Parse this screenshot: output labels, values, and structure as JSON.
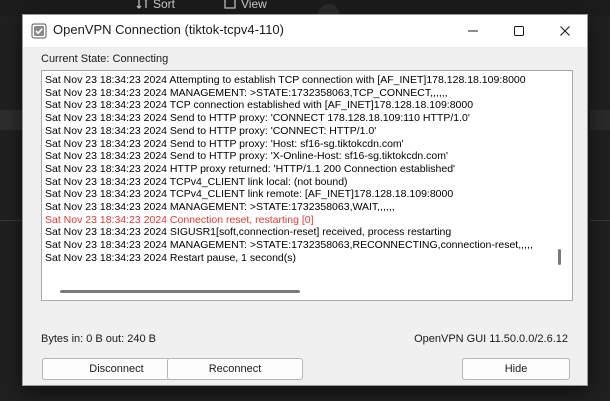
{
  "background_app": {
    "toolbar_items": [
      "Sort",
      "View"
    ]
  },
  "window": {
    "title": "OpenVPN Connection (tiktok-tcpv4-110)",
    "controls": {
      "minimize": "minimize-icon",
      "maximize": "maximize-icon",
      "close": "close-icon"
    }
  },
  "state": {
    "label": "Current State: Connecting"
  },
  "log": {
    "lines": [
      {
        "text": "Sat Nov 23 18:34:23 2024 Attempting to establish TCP connection with [AF_INET]178.128.18.109:8000",
        "level": "info"
      },
      {
        "text": "Sat Nov 23 18:34:23 2024 MANAGEMENT: >STATE:1732358063,TCP_CONNECT,,,,,,",
        "level": "info"
      },
      {
        "text": "Sat Nov 23 18:34:23 2024 TCP connection established with [AF_INET]178.128.18.109:8000",
        "level": "info"
      },
      {
        "text": "Sat Nov 23 18:34:23 2024 Send to HTTP proxy: 'CONNECT 178.128.18.109:110 HTTP/1.0'",
        "level": "info"
      },
      {
        "text": "Sat Nov 23 18:34:23 2024 Send to HTTP proxy: 'CONNECT: HTTP/1.0'",
        "level": "info"
      },
      {
        "text": "Sat Nov 23 18:34:23 2024 Send to HTTP proxy: 'Host: sf16-sg.tiktokcdn.com'",
        "level": "info"
      },
      {
        "text": "Sat Nov 23 18:34:23 2024 Send to HTTP proxy: 'X-Online-Host: sf16-sg.tiktokcdn.com'",
        "level": "info"
      },
      {
        "text": "Sat Nov 23 18:34:23 2024 HTTP proxy returned: 'HTTP/1.1 200 Connection established'",
        "level": "info"
      },
      {
        "text": "Sat Nov 23 18:34:23 2024 TCPv4_CLIENT link local: (not bound)",
        "level": "info"
      },
      {
        "text": "Sat Nov 23 18:34:23 2024 TCPv4_CLIENT link remote: [AF_INET]178.128.18.109:8000",
        "level": "info"
      },
      {
        "text": "Sat Nov 23 18:34:23 2024 MANAGEMENT: >STATE:1732358063,WAIT,,,,,,",
        "level": "info"
      },
      {
        "text": "Sat Nov 23 18:34:23 2024 Connection reset, restarting [0]",
        "level": "error"
      },
      {
        "text": "Sat Nov 23 18:34:23 2024 SIGUSR1[soft,connection-reset] received, process restarting",
        "level": "info"
      },
      {
        "text": "Sat Nov 23 18:34:23 2024 MANAGEMENT: >STATE:1732358063,RECONNECTING,connection-reset,,,,,",
        "level": "info"
      },
      {
        "text": "Sat Nov 23 18:34:23 2024 Restart pause, 1 second(s)",
        "level": "info"
      }
    ],
    "error_color": "#e53935"
  },
  "footer": {
    "bytes": "Bytes in: 0 B  out: 240 B",
    "version": "OpenVPN GUI 11.50.0.0/2.6.12"
  },
  "buttons": {
    "disconnect": "Disconnect",
    "reconnect": "Reconnect",
    "hide": "Hide"
  }
}
